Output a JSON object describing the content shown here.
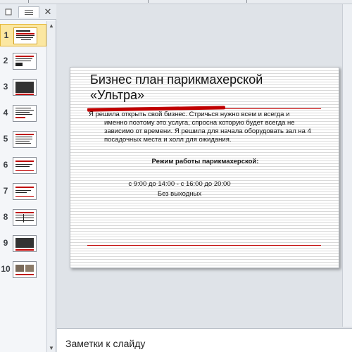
{
  "left_pane": {
    "tab_slides_icon": "square-icon",
    "tab_outline_icon": "list-icon",
    "close_glyph": "✕",
    "scroll_up_glyph": "▲",
    "scroll_down_glyph": "▼",
    "thumbnails": [
      {
        "number": "1",
        "selected": true
      },
      {
        "number": "2",
        "selected": false
      },
      {
        "number": "3",
        "selected": false
      },
      {
        "number": "4",
        "selected": false
      },
      {
        "number": "5",
        "selected": false
      },
      {
        "number": "6",
        "selected": false
      },
      {
        "number": "7",
        "selected": false
      },
      {
        "number": "8",
        "selected": false
      },
      {
        "number": "9",
        "selected": false
      },
      {
        "number": "10",
        "selected": false
      }
    ]
  },
  "slide": {
    "title": "Бизнес план парикмахерской\n«Ультра»",
    "body_first_line": "Я решила открыть свой бизнес. Стричься нужно всем и всегда и",
    "body_rest": "именно поэтому это услуга, спросна которую будет всегда не зависимо от времени. Я решила для начала оборудовать зал на 4 посадочных места и холл для ожидания.",
    "schedule_title": "Режим работы парикмахерской:",
    "schedule_hours": "с 9:00 до 14:00      -  с 16:00 до 20:00",
    "schedule_days": "Без выходных",
    "accent_color": "#c00000"
  },
  "notes": {
    "placeholder": "Заметки к слайду"
  }
}
